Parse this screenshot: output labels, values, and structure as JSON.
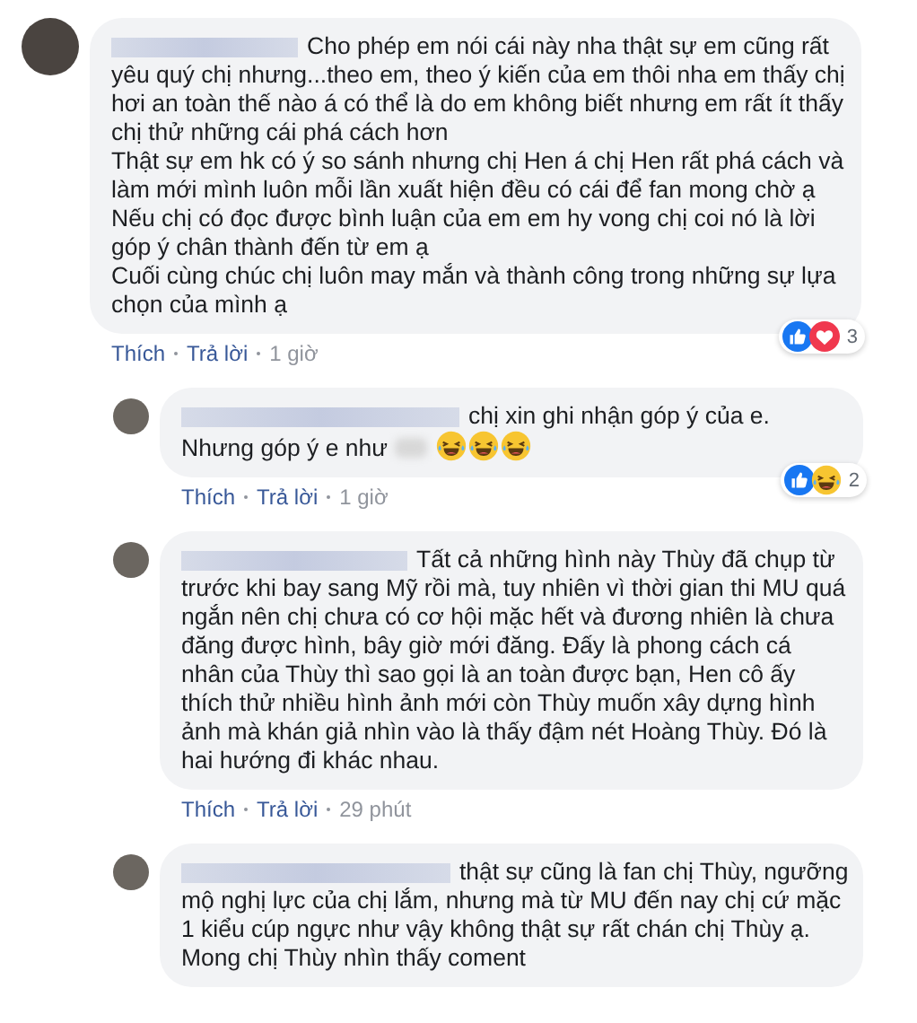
{
  "comments": [
    {
      "text": "Cho phép em nói cái này nha thật sự em cũng rất yêu quý chị nhưng...theo em, theo ý kiến của em thôi nha em thấy chị hơi an toàn thế nào á có thể là do em không biết nhưng em rất ít thấy chị thử những cái phá cách hơn\nThật sự em hk có ý so sánh nhưng chị Hen á chị Hen rất phá cách và làm mới mình luôn mỗi lần xuất hiện đều có cái để fan mong chờ ạ\nNếu chị có đọc được bình luận của em em hy vong chị coi nó là lời góp ý chân thành đến từ em ạ\nCuối cùng chúc chị luôn may mắn và thành công trong những sự lựa chọn của mình ạ",
      "actions": [
        "Thích",
        "Trả lời"
      ],
      "time": "1 giờ",
      "reactions": [
        {
          "kind": "like"
        },
        {
          "kind": "love"
        }
      ],
      "reaction_count": "3",
      "children": [
        {
          "text": "chị xin ghi nhận góp ý của e. Nhưng góp ý e như",
          "trailing_icons": [
            {
              "kind": "laughing"
            },
            {
              "kind": "laughing"
            },
            {
              "kind": "laughing"
            }
          ],
          "actions": [
            "Thích",
            "Trả lời"
          ],
          "time": "1 giờ",
          "reactions": [
            {
              "kind": "like"
            },
            {
              "kind": "haha"
            }
          ],
          "reaction_count": "2"
        },
        {
          "text": "Tất cả những hình này Thùy đã chụp từ trước khi bay sang Mỹ rồi mà, tuy nhiên vì thời gian thi MU quá ngắn nên chị chưa có cơ hội mặc hết và đương nhiên là chưa đăng được hình, bây giờ mới đăng. Đấy là phong cách cá nhân của Thùy thì sao gọi là an toàn được bạn, Hen cô ấy thích thử nhiều hình ảnh mới còn Thùy muốn xây dựng hình ảnh mà khán giả nhìn vào là thấy đậm nét Hoàng Thùy. Đó là hai hướng đi khác nhau.",
          "actions": [
            "Thích",
            "Trả lời"
          ],
          "time": "29 phút"
        },
        {
          "text": "thật sự cũng là fan chị Thùy, ngưỡng mộ nghị lực của chị lắm, nhưng mà từ MU đến nay chị cứ mặc 1 kiểu cúp ngực như vậy không thật sự rất chán chị Thùy ạ.\nMong chị Thùy nhìn thấy coment"
        }
      ]
    }
  ]
}
